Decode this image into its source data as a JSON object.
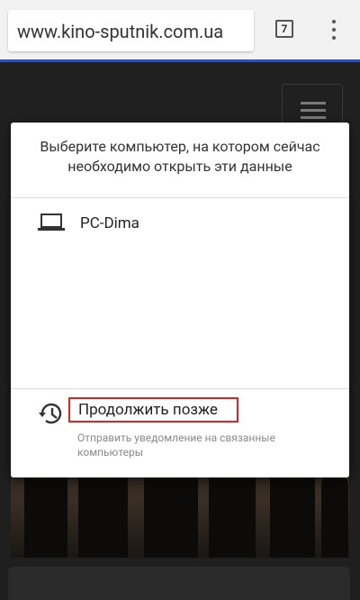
{
  "browser": {
    "url": "www.kino-sputnik.com.ua",
    "tab_count": "7"
  },
  "dialog": {
    "title": "Выберите компьютер, на котором сейчас необходимо открыть эти данные",
    "devices": [
      {
        "name": "PC-Dima",
        "icon": "laptop-icon"
      }
    ],
    "later": {
      "label": "Продолжить позже",
      "description": "Отправить уведомление на связанные компьютеры",
      "icon": "history-icon"
    }
  },
  "colors": {
    "accent_strip": "#2f4fbf",
    "highlight_border": "#e32222"
  }
}
